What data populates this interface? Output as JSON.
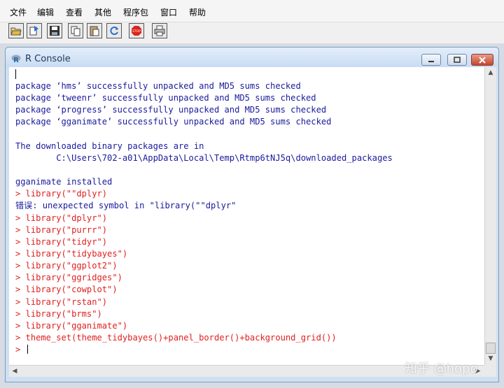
{
  "menu": [
    "文件",
    "编辑",
    "查看",
    "其他",
    "程序包",
    "窗口",
    "帮助"
  ],
  "toolbar": {
    "buttons": [
      "open-script-icon",
      "load-workspace-icon",
      "save-icon",
      "copy-icon",
      "paste-icon",
      "copy-paste-icon",
      "stop-icon",
      "print-icon"
    ],
    "stop_label": "STOP"
  },
  "window": {
    "title": "R Console",
    "controls": [
      "minimize-icon",
      "maximize-icon",
      "close-icon"
    ]
  },
  "console": {
    "lines": [
      {
        "type": "out",
        "text": "package ‘hms’ successfully unpacked and MD5 sums checked"
      },
      {
        "type": "out",
        "text": "package ‘tweenr’ successfully unpacked and MD5 sums checked"
      },
      {
        "type": "out",
        "text": "package ‘progress’ successfully unpacked and MD5 sums checked"
      },
      {
        "type": "out",
        "text": "package ‘gganimate’ successfully unpacked and MD5 sums checked"
      },
      {
        "type": "out",
        "text": ""
      },
      {
        "type": "out",
        "text": "The downloaded binary packages are in"
      },
      {
        "type": "out",
        "text": "        C:\\Users\\702-a01\\AppData\\Local\\Temp\\Rtmp6tNJ5q\\downloaded_packages"
      },
      {
        "type": "out",
        "text": ""
      },
      {
        "type": "out",
        "text": "gganimate installed"
      },
      {
        "type": "cmd",
        "text": "> library(\"\"dplyr)"
      },
      {
        "type": "out",
        "text": "错误: unexpected symbol in \"library(\"\"dplyr\""
      },
      {
        "type": "cmd",
        "text": "> library(\"dplyr\")"
      },
      {
        "type": "cmd",
        "text": "> library(\"purrr\")"
      },
      {
        "type": "cmd",
        "text": "> library(\"tidyr\")"
      },
      {
        "type": "cmd",
        "text": "> library(\"tidybayes\")"
      },
      {
        "type": "cmd",
        "text": "> library(\"ggplot2\")"
      },
      {
        "type": "cmd",
        "text": "> library(\"ggridges\")"
      },
      {
        "type": "cmd",
        "text": "> library(\"cowplot\")"
      },
      {
        "type": "cmd",
        "text": "> library(\"rstan\")"
      },
      {
        "type": "cmd",
        "text": "> library(\"brms\")"
      },
      {
        "type": "cmd",
        "text": "> library(\"gganimate\")"
      },
      {
        "type": "cmd",
        "text": "> theme_set(theme_tidybayes()+panel_border()+background_grid())"
      }
    ],
    "prompt": "> "
  },
  "watermark": "知乎 @hopo",
  "colors": {
    "output": "#1a1a9c",
    "command": "#e02020"
  }
}
